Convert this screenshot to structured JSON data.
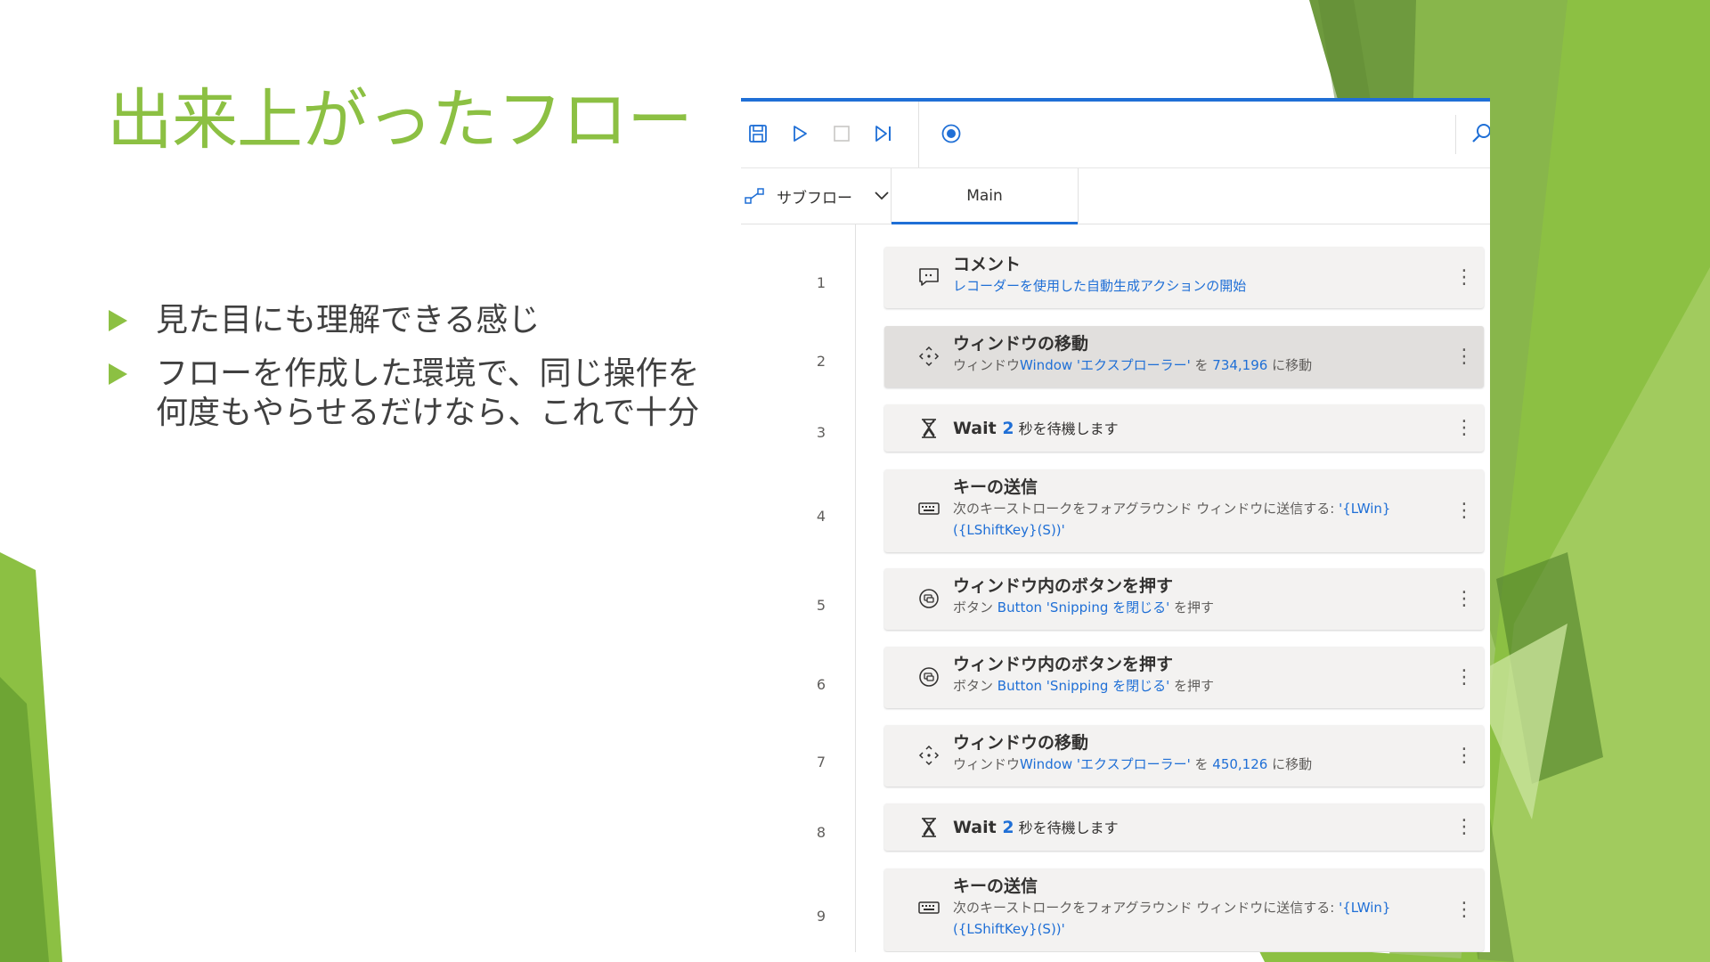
{
  "slide": {
    "title": "出来上がったフロー",
    "bullets": [
      "見た目にも理解できる感じ",
      "フローを作成した環境で、同じ操作を何度もやらせるだけなら、これで十分"
    ]
  },
  "colors": {
    "accent_green": "#8cc043",
    "highlight_blue": "#1f6fd6",
    "text_dark": "#323130",
    "text_muted": "#605e5c"
  },
  "editor": {
    "toolbar": {
      "icons": [
        "save-icon",
        "play-icon",
        "stop-icon",
        "step-icon",
        "record-icon",
        "search-icon"
      ]
    },
    "subflow_label": "サブフロー",
    "main_tab": "Main",
    "actions": [
      {
        "num": "1",
        "icon": "comment-icon",
        "title": "コメント",
        "desc_parts": [
          {
            "text": "レコーダーを使用した自動生成アクションの開始",
            "hl": true
          }
        ]
      },
      {
        "num": "2",
        "icon": "move-icon",
        "title": "ウィンドウの移動",
        "desc_parts": [
          {
            "text": "ウィンドウ",
            "hl": false
          },
          {
            "text": "Window 'エクスプローラー'",
            "hl": true
          },
          {
            "text": " を ",
            "hl": false
          },
          {
            "text": "734,196",
            "hl": true
          },
          {
            "text": " に移動",
            "hl": false
          }
        ]
      },
      {
        "num": "3",
        "icon": "hourglass-icon",
        "inline_title": [
          {
            "text": "Wait ",
            "hl": false
          },
          {
            "text": "2",
            "hl": true
          },
          {
            "text": " 秒を待機します",
            "hl": false,
            "normal": true
          }
        ]
      },
      {
        "num": "4",
        "icon": "keyboard-icon",
        "title": "キーの送信",
        "desc_parts": [
          {
            "text": "次のキーストロークをフォアグラウンド ウィンドウに送信する: ",
            "hl": false
          },
          {
            "text": "'{LWin}({LShiftKey}(S))'",
            "hl": true
          }
        ]
      },
      {
        "num": "5",
        "icon": "button-press-icon",
        "title": "ウィンドウ内のボタンを押す",
        "desc_parts": [
          {
            "text": "ボタン ",
            "hl": false
          },
          {
            "text": "Button 'Snipping を閉じる'",
            "hl": true
          },
          {
            "text": " を押す",
            "hl": false
          }
        ]
      },
      {
        "num": "6",
        "icon": "button-press-icon",
        "title": "ウィンドウ内のボタンを押す",
        "desc_parts": [
          {
            "text": "ボタン ",
            "hl": false
          },
          {
            "text": "Button 'Snipping を閉じる'",
            "hl": true
          },
          {
            "text": " を押す",
            "hl": false
          }
        ]
      },
      {
        "num": "7",
        "icon": "move-icon",
        "title": "ウィンドウの移動",
        "desc_parts": [
          {
            "text": "ウィンドウ",
            "hl": false
          },
          {
            "text": "Window 'エクスプローラー'",
            "hl": true
          },
          {
            "text": " を ",
            "hl": false
          },
          {
            "text": "450,126",
            "hl": true
          },
          {
            "text": " に移動",
            "hl": false
          }
        ]
      },
      {
        "num": "8",
        "icon": "hourglass-icon",
        "inline_title": [
          {
            "text": "Wait ",
            "hl": false
          },
          {
            "text": "2",
            "hl": true
          },
          {
            "text": " 秒を待機します",
            "hl": false,
            "normal": true
          }
        ]
      },
      {
        "num": "9",
        "icon": "keyboard-icon",
        "title": "キーの送信",
        "desc_parts": [
          {
            "text": "次のキーストロークをフォアグラウンド ウィンドウに送信する: ",
            "hl": false
          },
          {
            "text": "'{LWin}({LShiftKey}(S))'",
            "hl": true
          }
        ]
      }
    ]
  }
}
